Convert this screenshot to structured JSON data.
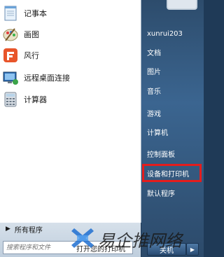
{
  "programs": [
    {
      "label": "记事本",
      "icon": "notepad-icon"
    },
    {
      "label": "画图",
      "icon": "paint-icon"
    },
    {
      "label": "风行",
      "icon": "funshion-icon"
    },
    {
      "label": "远程桌面连接",
      "icon": "remote-desktop-icon"
    },
    {
      "label": "计算器",
      "icon": "calculator-icon"
    }
  ],
  "all_programs_label": "所有程序",
  "search": {
    "placeholder": "搜索程序和文件",
    "overlay_text": "打开您的打印机"
  },
  "user": {
    "name": "xunrui203"
  },
  "right_menu": [
    {
      "label": "文档"
    },
    {
      "label": "图片"
    },
    {
      "label": "音乐"
    },
    {
      "label": "游戏"
    },
    {
      "label": "计算机"
    },
    {
      "label": "控制面板"
    },
    {
      "label": "设备和打印机"
    },
    {
      "label": "默认程序"
    }
  ],
  "shutdown_label": "关机",
  "watermark_text": "易企推网络",
  "colors": {
    "highlight": "#e41d1d",
    "watermark_logo": "#1e6fd0"
  }
}
